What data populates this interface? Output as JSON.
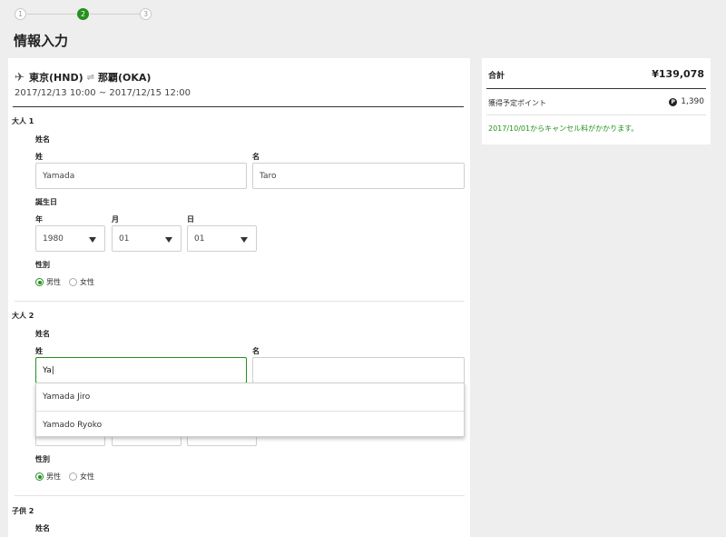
{
  "stepper": {
    "steps": [
      "1",
      "2",
      "3"
    ]
  },
  "page_title": "情報入力",
  "flight": {
    "from": "東京(HND)",
    "to": "那覇(OKA)",
    "dates": "2017/12/13 10:00 ~ 2017/12/15 12:00"
  },
  "adult1": {
    "heading": "大人 1",
    "name_label": "姓名",
    "last_label": "姓",
    "first_label": "名",
    "last_value": "Yamada",
    "first_value": "Taro",
    "birthday_label": "誕生日",
    "year_label": "年",
    "month_label": "月",
    "day_label": "日",
    "year_value": "1980",
    "month_value": "01",
    "day_value": "01",
    "gender_label": "性別",
    "male": "男性",
    "female": "女性"
  },
  "adult2": {
    "heading": "大人 2",
    "name_label": "姓名",
    "last_label": "姓",
    "first_label": "名",
    "last_value": "Ya|",
    "first_value": "",
    "suggestions": [
      "Yamada Jiro",
      "Yamado Ryoko"
    ],
    "gender_label": "性別",
    "male": "男性",
    "female": "女性"
  },
  "child2": {
    "heading": "子供 2",
    "name_label": "姓名"
  },
  "summary": {
    "total_label": "合計",
    "total_value": "¥139,078",
    "points_label": "獲得予定ポイント",
    "points_value": "1,390",
    "points_icon": "P",
    "cancel_note": "2017/10/01からキャンセル料がかかります。"
  },
  "colors": {
    "accent": "#24911e",
    "background": "#eeeeee"
  }
}
